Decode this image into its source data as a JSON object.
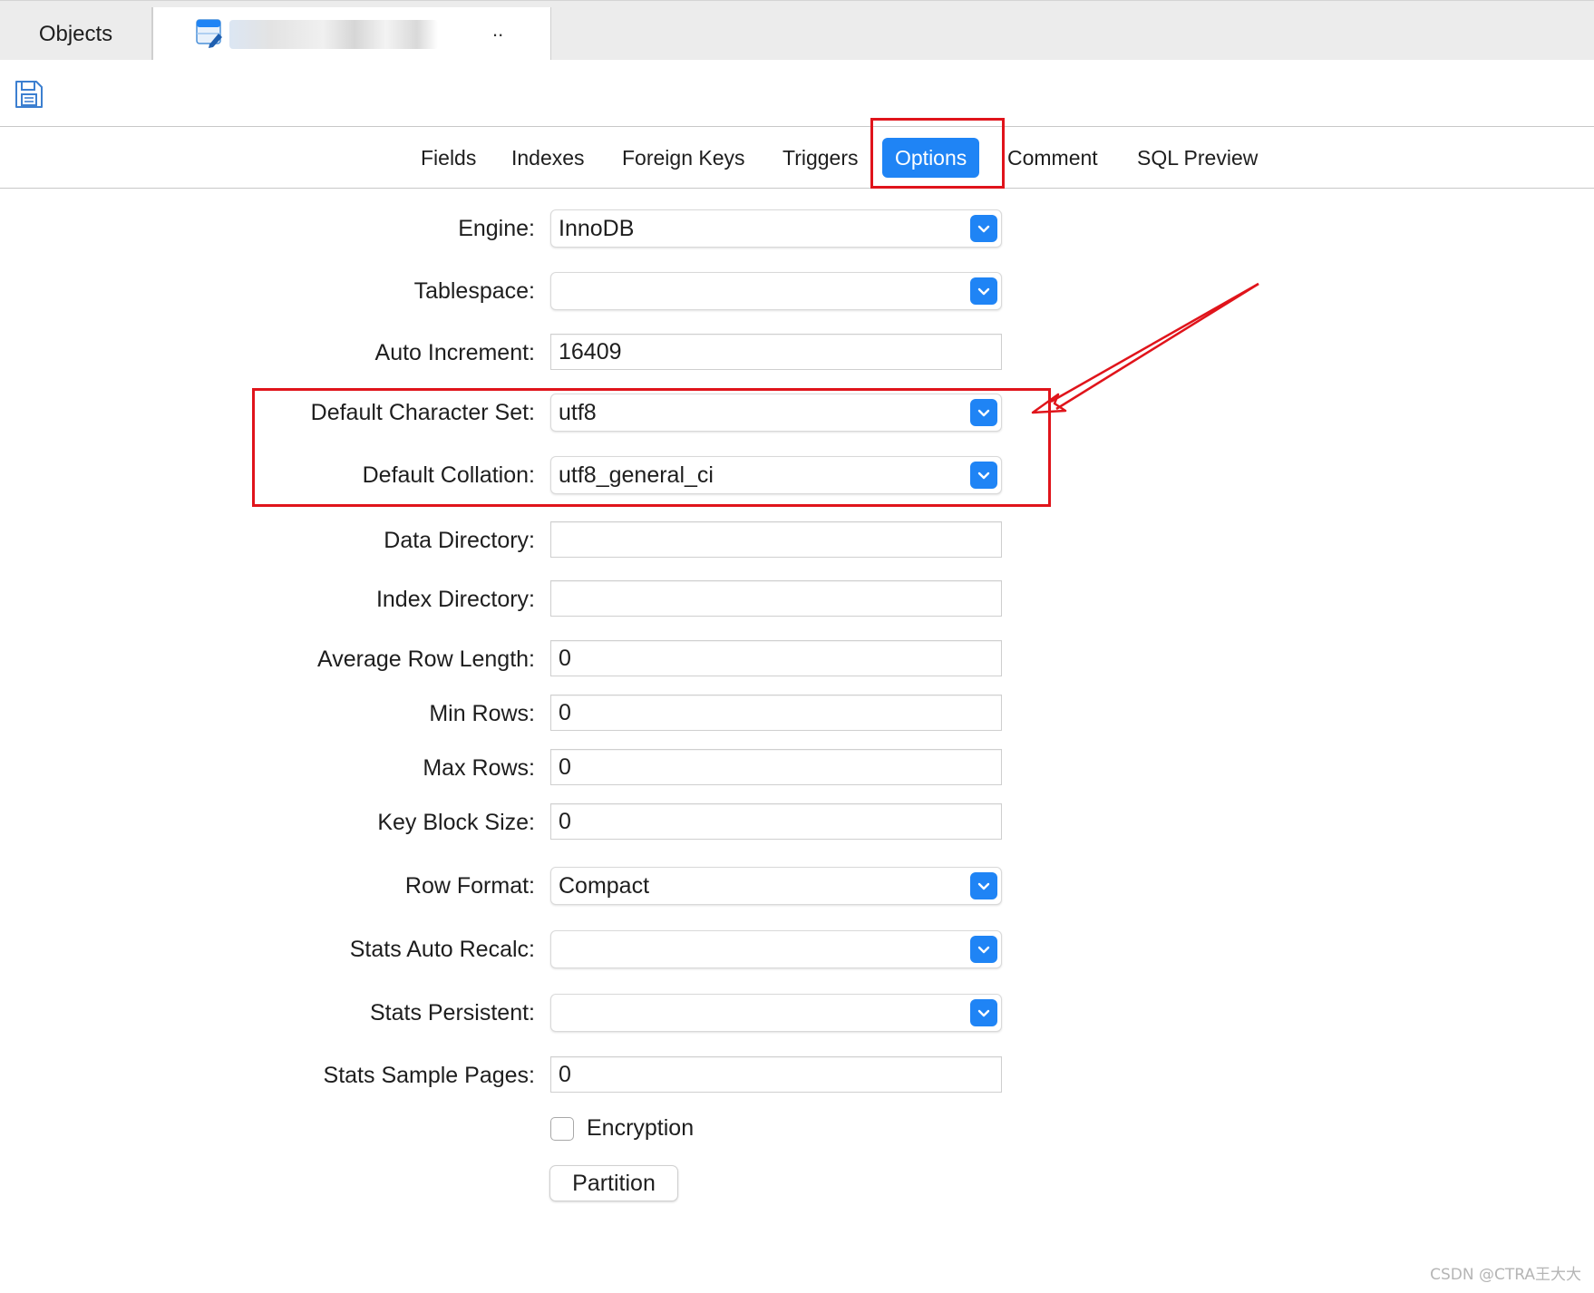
{
  "tabs": {
    "objects_label": "Objects",
    "active_tab_suffix": ".."
  },
  "subtabs": [
    "Fields",
    "Indexes",
    "Foreign Keys",
    "Triggers",
    "Options",
    "Comment",
    "SQL Preview"
  ],
  "active_subtab": "Options",
  "form": {
    "engine": {
      "label": "Engine:",
      "value": "InnoDB"
    },
    "tablespace": {
      "label": "Tablespace:",
      "value": ""
    },
    "auto_increment": {
      "label": "Auto Increment:",
      "value": "16409"
    },
    "default_charset": {
      "label": "Default Character Set:",
      "value": "utf8"
    },
    "default_collation": {
      "label": "Default Collation:",
      "value": "utf8_general_ci"
    },
    "data_directory": {
      "label": "Data Directory:",
      "value": ""
    },
    "index_directory": {
      "label": "Index Directory:",
      "value": ""
    },
    "avg_row_length": {
      "label": "Average Row Length:",
      "value": "0"
    },
    "min_rows": {
      "label": "Min Rows:",
      "value": "0"
    },
    "max_rows": {
      "label": "Max Rows:",
      "value": "0"
    },
    "key_block_size": {
      "label": "Key Block Size:",
      "value": "0"
    },
    "row_format": {
      "label": "Row Format:",
      "value": "Compact"
    },
    "stats_auto_recalc": {
      "label": "Stats Auto Recalc:",
      "value": ""
    },
    "stats_persistent": {
      "label": "Stats Persistent:",
      "value": ""
    },
    "stats_sample_pages": {
      "label": "Stats Sample Pages:",
      "value": "0"
    },
    "encryption": {
      "label": "Encryption",
      "checked": false
    },
    "partition_label": "Partition"
  },
  "watermark": "CSDN @CTRA王大大",
  "colors": {
    "accent": "#1f84f5",
    "annotation": "#e0141b"
  }
}
